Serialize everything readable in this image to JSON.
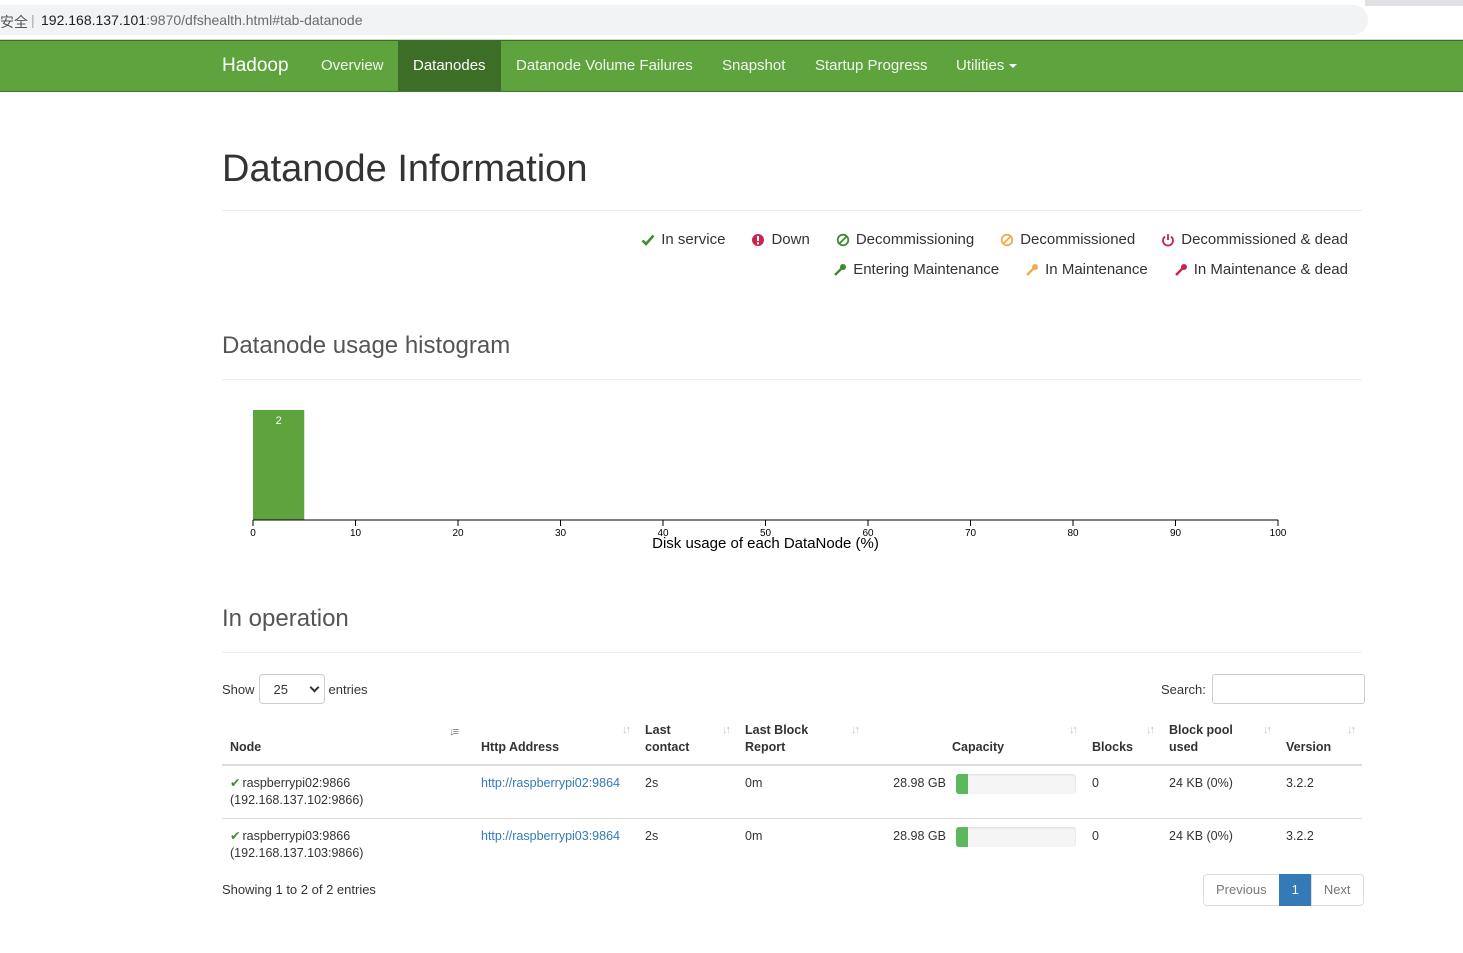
{
  "browser": {
    "security_label": "安全",
    "separator": "|",
    "url_host": "192.168.137.101",
    "url_rest": ":9870/dfshealth.html#tab-datanode"
  },
  "navbar": {
    "brand": "Hadoop",
    "items": [
      "Overview",
      "Datanodes",
      "Datanode Volume Failures",
      "Snapshot",
      "Startup Progress",
      "Utilities"
    ],
    "active_index": 1,
    "color": "#5fa33f"
  },
  "page": {
    "title": "Datanode Information"
  },
  "legend": {
    "row1": [
      {
        "label": "In service",
        "icon": "check-icon",
        "color": "#3c8d2f"
      },
      {
        "label": "Down",
        "icon": "exclamation-circle-icon",
        "color": "#c7254e"
      },
      {
        "label": "Decommissioning",
        "icon": "ban-icon",
        "color": "#3c8d2f"
      },
      {
        "label": "Decommissioned",
        "icon": "ban-icon",
        "color": "#f0ad4e"
      },
      {
        "label": "Decommissioned & dead",
        "icon": "power-icon",
        "color": "#c7254e"
      }
    ],
    "row2": [
      {
        "label": "Entering Maintenance",
        "icon": "wrench-icon",
        "color": "#3c8d2f"
      },
      {
        "label": "In Maintenance",
        "icon": "wrench-icon",
        "color": "#f0ad4e"
      },
      {
        "label": "In Maintenance & dead",
        "icon": "wrench-icon",
        "color": "#c7254e"
      }
    ]
  },
  "histogram": {
    "heading": "Datanode usage histogram"
  },
  "chart_data": {
    "type": "bar",
    "xlabel": "Disk usage of each DataNode (%)",
    "xlim": [
      0,
      100
    ],
    "x_ticks": [
      0,
      10,
      20,
      30,
      40,
      50,
      60,
      70,
      80,
      90,
      100
    ],
    "bins": [
      {
        "from": 0,
        "to": 5,
        "count": 2
      }
    ],
    "bar_color": "#5fa33f"
  },
  "operation": {
    "heading": "In operation",
    "show_label": "Show",
    "page_size": "25",
    "entries_label": "entries",
    "search_label": "Search:",
    "columns": [
      "Node",
      "Http Address",
      "Last contact",
      "Last Block Report",
      "Capacity",
      "Blocks",
      "Block pool used",
      "Version"
    ],
    "column_lines": [
      [
        "Node"
      ],
      [
        "Http Address"
      ],
      [
        "Last",
        "contact"
      ],
      [
        "Last Block",
        "Report"
      ],
      [
        "Capacity"
      ],
      [
        "Blocks"
      ],
      [
        "Block pool",
        "used"
      ],
      [
        "Version"
      ]
    ],
    "rows": [
      {
        "node": "raspberrypi02:9866",
        "node_ip": "(192.168.137.102:9866)",
        "http": "http://raspberrypi02:9864",
        "last_contact": "2s",
        "last_block_report": "0m",
        "capacity": "28.98 GB",
        "capacity_used_fraction": 0.1,
        "blocks": "0",
        "block_pool_used": "24 KB (0%)",
        "version": "3.2.2"
      },
      {
        "node": "raspberrypi03:9866",
        "node_ip": "(192.168.137.103:9866)",
        "http": "http://raspberrypi03:9864",
        "last_contact": "2s",
        "last_block_report": "0m",
        "capacity": "28.98 GB",
        "capacity_used_fraction": 0.1,
        "blocks": "0",
        "block_pool_used": "24 KB (0%)",
        "version": "3.2.2"
      }
    ],
    "info": "Showing 1 to 2 of 2 entries",
    "pager": {
      "previous": "Previous",
      "current": "1",
      "next": "Next"
    }
  }
}
